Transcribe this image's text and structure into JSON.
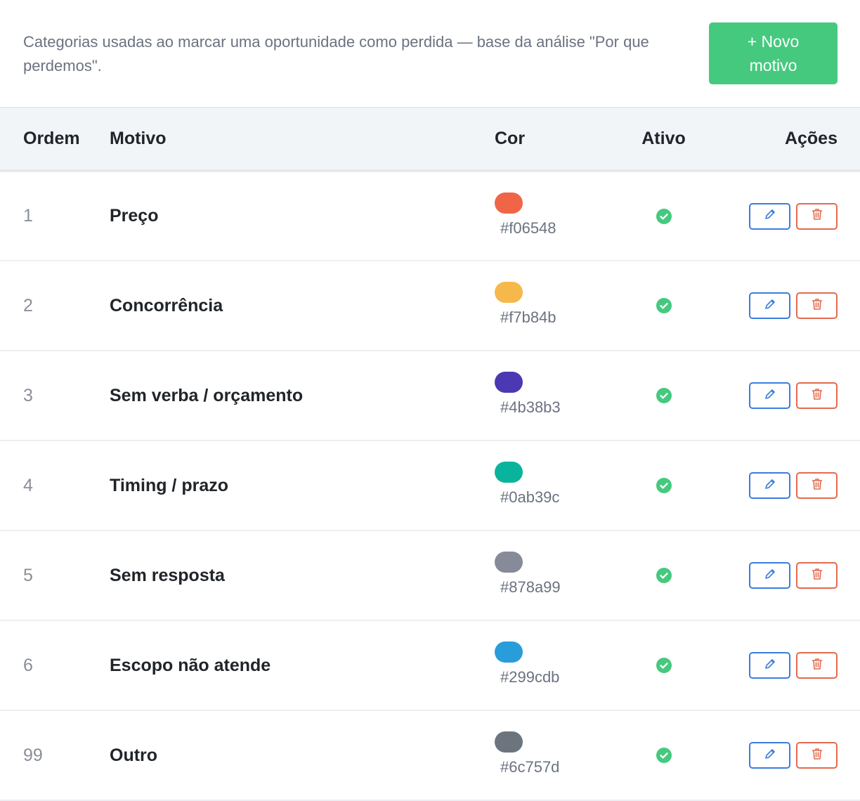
{
  "header": {
    "description": "Categorias usadas ao marcar uma oportunidade como perdida — base da análise \"Por que perdemos\".",
    "new_button_label": "+ Novo motivo"
  },
  "table": {
    "columns": {
      "order": "Ordem",
      "reason": "Motivo",
      "color": "Cor",
      "active": "Ativo",
      "actions": "Ações"
    },
    "rows": [
      {
        "order": "1",
        "reason": "Preço",
        "color": "#f06548",
        "active": true
      },
      {
        "order": "2",
        "reason": "Concorrência",
        "color": "#f7b84b",
        "active": true
      },
      {
        "order": "3",
        "reason": "Sem verba / orçamento",
        "color": "#4b38b3",
        "active": true
      },
      {
        "order": "4",
        "reason": "Timing / prazo",
        "color": "#0ab39c",
        "active": true
      },
      {
        "order": "5",
        "reason": "Sem resposta",
        "color": "#878a99",
        "active": true
      },
      {
        "order": "6",
        "reason": "Escopo não atende",
        "color": "#299cdb",
        "active": true
      },
      {
        "order": "99",
        "reason": "Outro",
        "color": "#6c757d",
        "active": true
      }
    ]
  },
  "icons": {
    "active": "check-circle-icon",
    "edit": "pencil-icon",
    "delete": "trash-icon"
  },
  "colors": {
    "primary_action": "#45c97f",
    "edit_outline": "#3b7ddd",
    "delete_outline": "#e36a4f"
  }
}
